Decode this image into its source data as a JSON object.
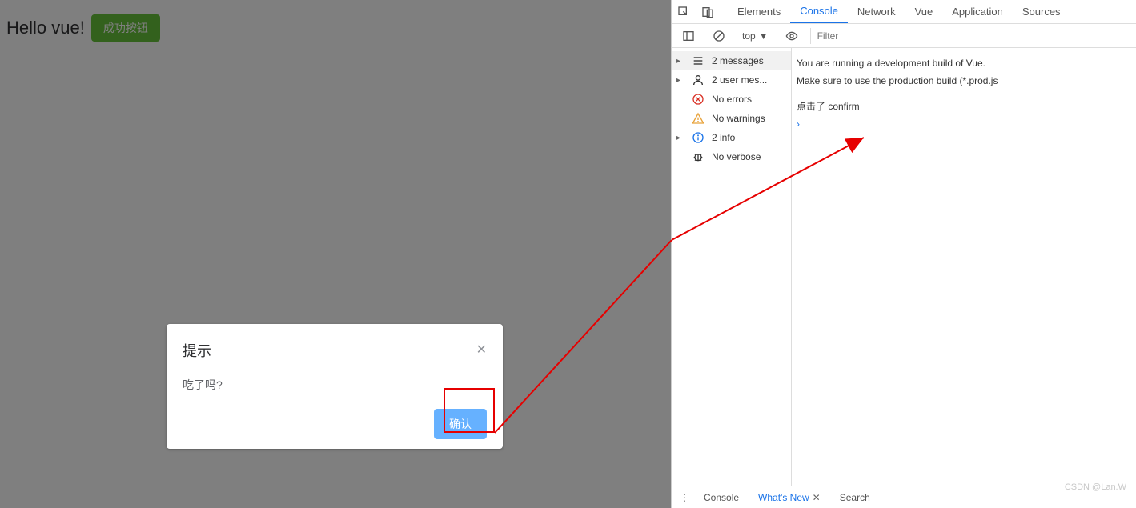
{
  "page": {
    "heading": "Hello vue!",
    "success_button": "成功按钮"
  },
  "dialog": {
    "title": "提示",
    "body": "吃了吗?",
    "confirm_label": "确认"
  },
  "devtools": {
    "tabs": {
      "elements": "Elements",
      "console": "Console",
      "network": "Network",
      "vue": "Vue",
      "application": "Application",
      "sources": "Sources"
    },
    "context_selector": "top",
    "filter_placeholder": "Filter",
    "sidebar": {
      "messages": "2 messages",
      "user_messages": "2 user mes...",
      "errors": "No errors",
      "warnings": "No warnings",
      "info": "2 info",
      "verbose": "No verbose"
    },
    "logs": {
      "vue_dev1": "You are running a development build of Vue.",
      "vue_dev2": "Make sure to use the production build (*.prod.js",
      "click_confirm": "点击了 confirm"
    },
    "drawer": {
      "console": "Console",
      "whatsnew": "What's New",
      "search": "Search"
    }
  },
  "watermark": "CSDN @Lan.W"
}
